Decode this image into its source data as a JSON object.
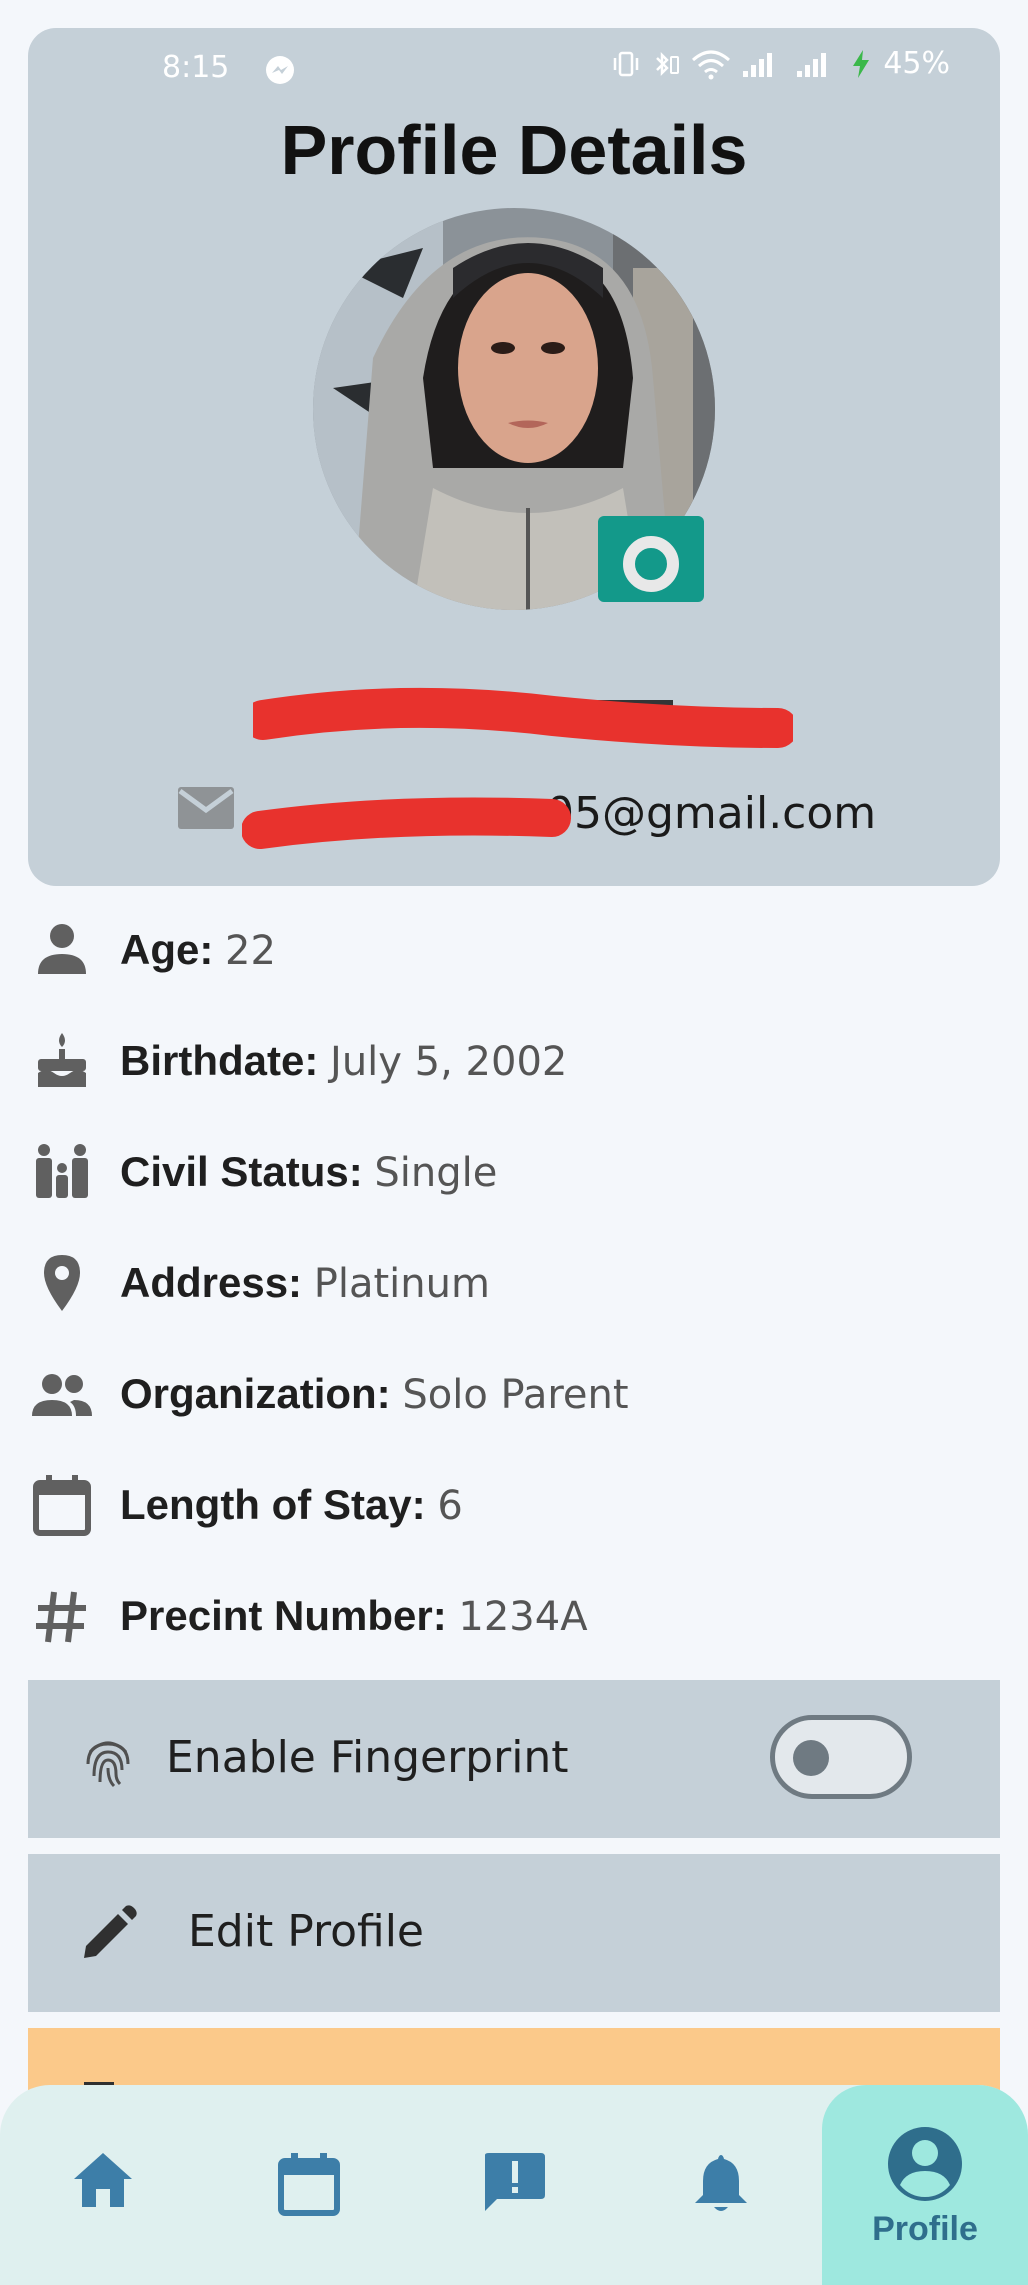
{
  "status_bar": {
    "time": "8:15",
    "battery": "45%",
    "icons": [
      "messenger-icon",
      "vibrate-icon",
      "bluetooth-battery-icon",
      "wifi-icon",
      "signal-icon",
      "signal-icon",
      "charging-icon"
    ]
  },
  "page": {
    "title": "Profile Details"
  },
  "profile": {
    "email_visible_suffix": "05@gmail.com",
    "name_redacted": true,
    "email_prefix_redacted": true
  },
  "details": [
    {
      "icon": "person-icon",
      "label": "Age:",
      "value": "22"
    },
    {
      "icon": "cake-icon",
      "label": "Birthdate:",
      "value": "July 5, 2002"
    },
    {
      "icon": "family-icon",
      "label": "Civil Status:",
      "value": "Single"
    },
    {
      "icon": "location-pin-icon",
      "label": "Address:",
      "value": "Platinum"
    },
    {
      "icon": "group-icon",
      "label": "Organization:",
      "value": "Solo Parent"
    },
    {
      "icon": "calendar-icon",
      "label": "Length of Stay:",
      "value": "6"
    },
    {
      "icon": "hash-icon",
      "label": "Precint Number:",
      "value": "1234A"
    }
  ],
  "settings": {
    "fingerprint_label": "Enable Fingerprint",
    "fingerprint_enabled": false,
    "edit_label": "Edit Profile"
  },
  "nav": {
    "items": [
      {
        "icon": "home-icon",
        "label": ""
      },
      {
        "icon": "calendar-icon",
        "label": ""
      },
      {
        "icon": "feedback-icon",
        "label": ""
      },
      {
        "icon": "bell-icon",
        "label": ""
      },
      {
        "icon": "account-circle-icon",
        "label": "Profile",
        "active": true
      }
    ]
  },
  "colors": {
    "card_bg": "#c5d0d8",
    "page_bg": "#f4f7fb",
    "camera_accent": "#13998a",
    "nav_bg": "#dff0ef",
    "nav_active_bg": "#9ee8df",
    "nav_icon": "#3d7ea8",
    "redaction": "#e8322d",
    "orange_panel": "#fbc98a"
  }
}
